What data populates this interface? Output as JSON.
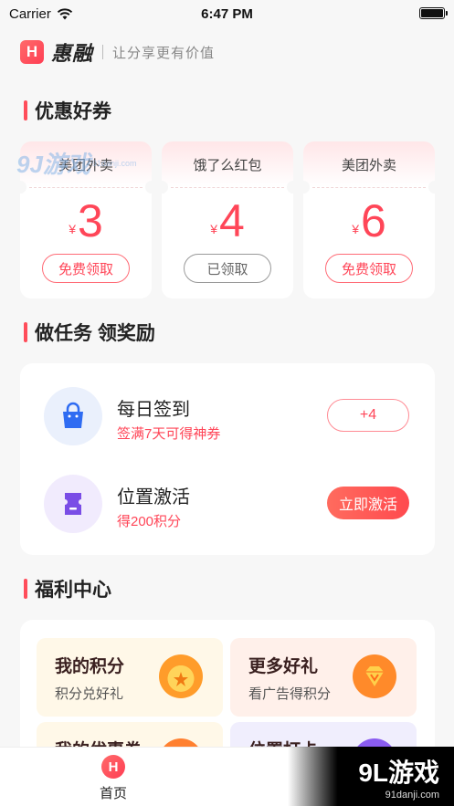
{
  "status": {
    "carrier": "Carrier",
    "time": "6:47 PM",
    "battery_level": 1.0
  },
  "header": {
    "logo_glyph": "H",
    "brand": "惠融",
    "slogan": "让分享更有价值"
  },
  "sections": {
    "coupons": "优惠好券",
    "tasks": "做任务 领奖励",
    "welfare": "福利中心"
  },
  "coupons": [
    {
      "name": "美团外卖",
      "currency": "¥",
      "amount": "3",
      "button": "免费领取",
      "claimed": false
    },
    {
      "name": "饿了么红包",
      "currency": "¥",
      "amount": "4",
      "button": "已领取",
      "claimed": true
    },
    {
      "name": "美团外卖",
      "currency": "¥",
      "amount": "6",
      "button": "免费领取",
      "claimed": false
    }
  ],
  "tasks": [
    {
      "title": "每日签到",
      "subtitle": "签满7天可得神券",
      "button": "+4",
      "icon": "shopping-bag-icon"
    },
    {
      "title": "位置激活",
      "subtitle": "得200积分",
      "button": "立即激活",
      "icon": "ticket-icon"
    }
  ],
  "welfare": [
    {
      "title": "我的积分",
      "subtitle": "积分兑好礼",
      "icon": "coin-star-icon"
    },
    {
      "title": "更多好礼",
      "subtitle": "看广告得积分",
      "icon": "diamond-icon"
    },
    {
      "title": "我的优惠券",
      "subtitle": "",
      "icon": "coupon-icon"
    },
    {
      "title": "位置打卡",
      "subtitle": "",
      "icon": "location-icon"
    }
  ],
  "tabbar": {
    "home_label": "首页",
    "home_glyph": "H"
  },
  "watermarks": {
    "top_big": "9J游戏",
    "top_small": "91danji.com",
    "bottom_big": "9L游戏",
    "bottom_small": "91danji.com"
  },
  "colors": {
    "accent": "#ff4658",
    "page_bg": "#f7f7f7"
  }
}
